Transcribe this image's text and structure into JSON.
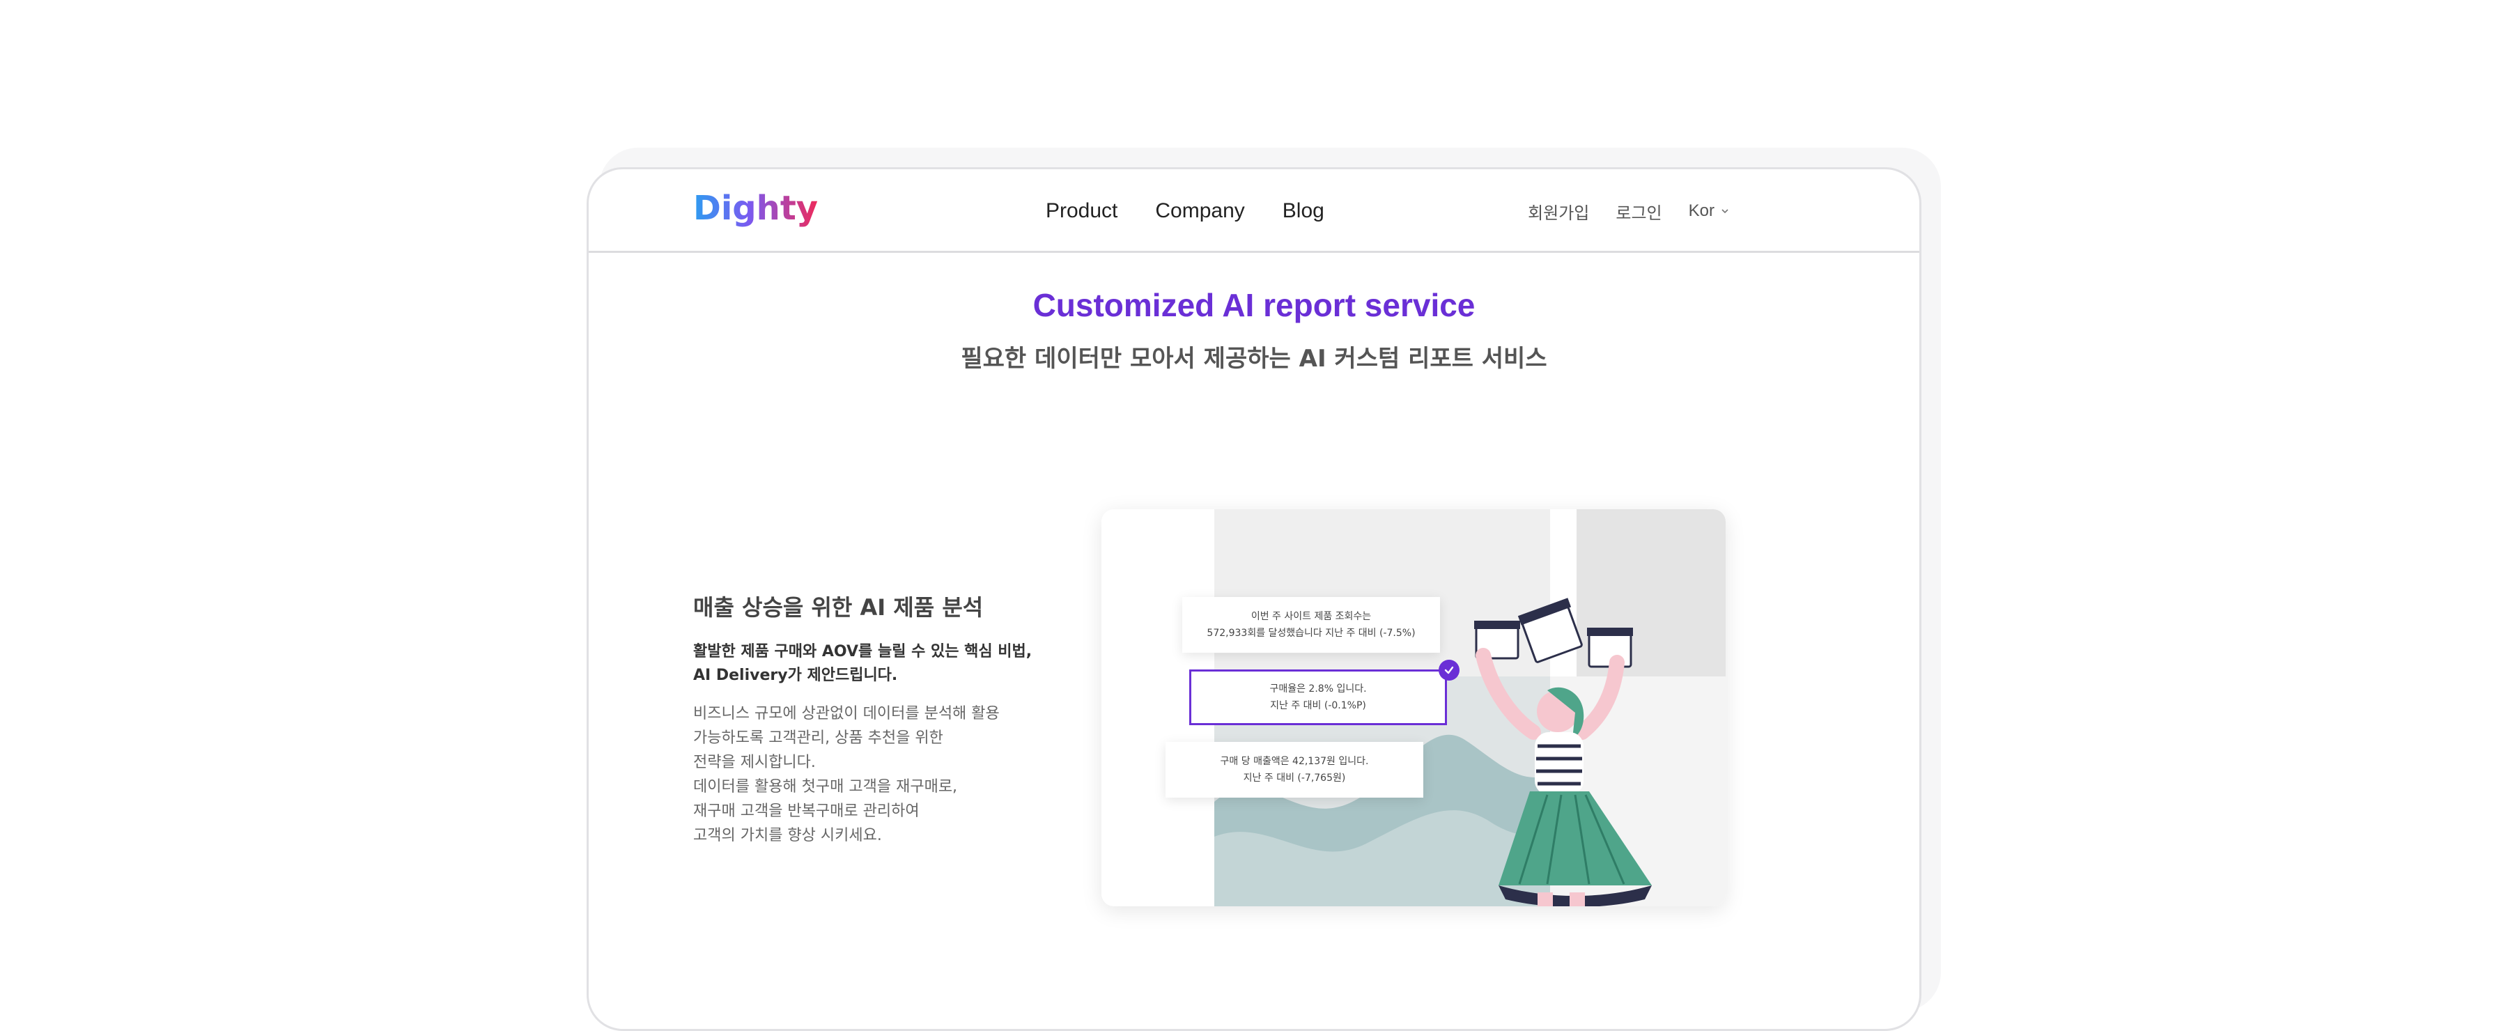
{
  "header": {
    "logo_text": "Dighty",
    "nav": [
      "Product",
      "Company",
      "Blog"
    ],
    "signup": "회원가입",
    "login": "로그인",
    "language": "Kor"
  },
  "hero": {
    "title": "Customized AI report service",
    "subtitle": "필요한 데이터만 모아서 제공하는 AI 커스텀 리포트 서비스"
  },
  "section": {
    "title": "매출 상승을 위한 AI 제품 분석",
    "highlight_lines": [
      "활발한 제품 구매와 AOV를 늘릴 수 있는 핵심 비법,",
      "AI Delivery가 제안드립니다."
    ],
    "body_lines": [
      "비즈니스 규모에 상관없이 데이터를 분석해 활용",
      "가능하도록 고객관리, 상품 추천을 위한",
      "전략을 제시합니다.",
      "데이터를 활용해 첫구매 고객을 재구매로,",
      "재구매 고객을 반복구매로 관리하여",
      "고객의 가치를 향상 시키세요."
    ]
  },
  "illustration": {
    "cards": [
      {
        "line1": "이번 주 사이트 제품 조회수는",
        "line2": "572,933회를 달성했습니다 지난 주 대비 (-7.5%)"
      },
      {
        "line1": "구매율은 2.8% 입니다.",
        "line2": "지난 주 대비 (-0.1%P)"
      },
      {
        "line1": "구매 당 매출액은 42,137원 입니다.",
        "line2": "지난 주 대비 (-7,765원)"
      }
    ],
    "colors": {
      "accent": "#6a2fd6",
      "skirt": "#4fa58a",
      "skin": "#f6c7cf",
      "wave": "#a9c4c6"
    }
  }
}
